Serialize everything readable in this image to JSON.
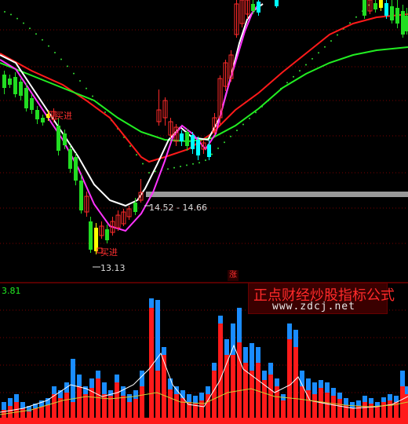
{
  "colors": {
    "background": "#000000",
    "up_candle": "#ff2a2a",
    "down_candle": "#00ffff",
    "green_candle": "#22dd22",
    "yellow_candle": "#ffff00",
    "ma_white": "#ffffff",
    "ma_magenta": "#ff33ff",
    "ma_red": "#ff1a1a",
    "ma_green": "#22ee22",
    "dotted": "#33dd33",
    "band": "#9a9a9a",
    "grid": "#7a0000",
    "vol_red": "#ff1a1a",
    "vol_blue": "#1a8cff"
  },
  "labels": {
    "buy_top": "买进",
    "buy_bottom": "买进",
    "band_label": "14.52 - 14.66",
    "low_label": "13.13",
    "vol_value": "3.81",
    "zhang": "涨",
    "watermark_title": "正点财经炒股指标公式",
    "watermark_url": "www.zdcj.net"
  },
  "chart_data": [
    {
      "type": "candlestick",
      "annotations": [
        "买进",
        "买进",
        "14.52 - 14.66",
        "13.13"
      ],
      "series": [
        {
          "name": "",
          "type": "line",
          "color": "white"
        },
        {
          "name": "",
          "type": "line",
          "color": "magenta"
        },
        {
          "name": "",
          "type": "line",
          "color": "red"
        },
        {
          "name": "",
          "type": "line",
          "color": "green"
        },
        {
          "name": "",
          "type": "dotted",
          "color": "green"
        }
      ],
      "band": {
        "low": 14.52,
        "high": 14.66
      },
      "low": 13.13
    },
    {
      "type": "bar",
      "ylabel_value": "3.81",
      "series": [
        {
          "name": "",
          "color": "red"
        },
        {
          "name": "",
          "color": "blue"
        }
      ]
    }
  ]
}
